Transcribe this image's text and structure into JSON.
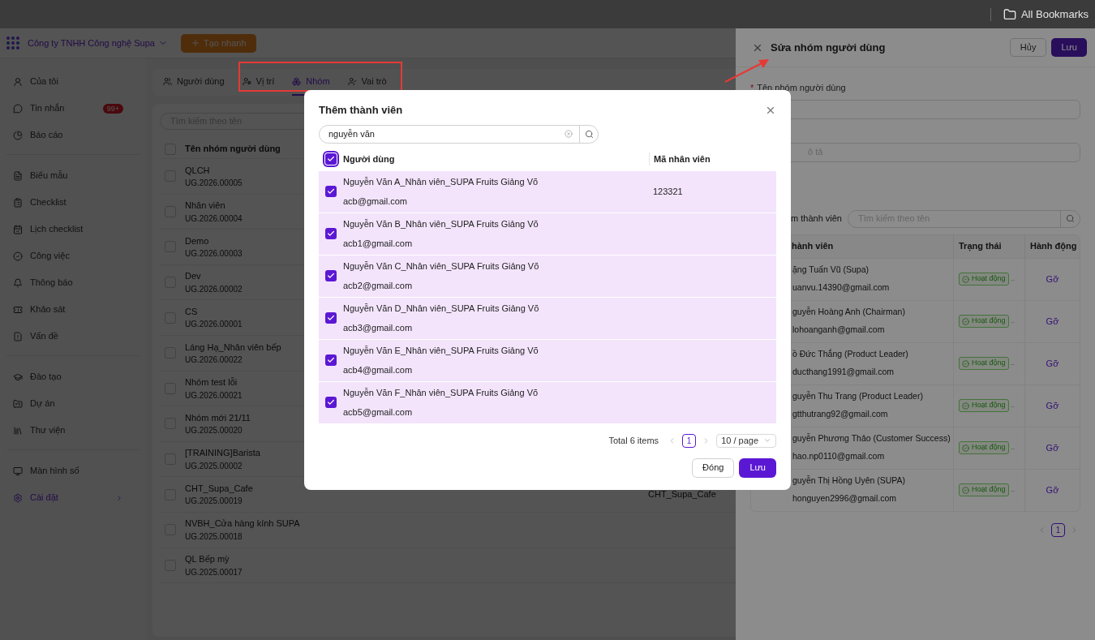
{
  "browser_bar": {
    "bookmarks": "All Bookmarks"
  },
  "header": {
    "company": "Công ty TNHH Công nghệ Supa",
    "quick_create": "Tạo nhanh"
  },
  "sidebar": {
    "sections": [
      {
        "items": [
          {
            "label": "Của tôi",
            "selected": false,
            "expandable": false
          },
          {
            "label": "Tin nhắn",
            "badge": "99+",
            "selected": false,
            "expandable": false
          },
          {
            "label": "Báo cáo",
            "selected": false,
            "expandable": false
          }
        ]
      },
      {
        "items": [
          {
            "label": "Biểu mẫu",
            "selected": false,
            "expandable": false
          },
          {
            "label": "Checklist",
            "selected": false,
            "expandable": false
          },
          {
            "label": "Lịch checklist",
            "selected": false,
            "expandable": false
          },
          {
            "label": "Công việc",
            "selected": false,
            "expandable": false
          },
          {
            "label": "Thông báo",
            "selected": false,
            "expandable": false
          },
          {
            "label": "Khảo sát",
            "selected": false,
            "expandable": false
          },
          {
            "label": "Vấn đề",
            "selected": false,
            "expandable": false
          }
        ]
      },
      {
        "items": [
          {
            "label": "Đào tạo",
            "selected": false,
            "expandable": false
          },
          {
            "label": "Dự án",
            "selected": false,
            "expandable": false
          },
          {
            "label": "Thư viện",
            "selected": false,
            "expandable": false
          }
        ]
      },
      {
        "items": [
          {
            "label": "Màn hình số",
            "selected": false,
            "expandable": false
          },
          {
            "label": "Cài đặt",
            "selected": true,
            "expandable": true
          }
        ]
      }
    ]
  },
  "tabs": [
    {
      "label": "Người dùng",
      "selected": false
    },
    {
      "label": "Vị trí",
      "selected": false
    },
    {
      "label": "Nhóm",
      "selected": true
    },
    {
      "label": "Vai trò",
      "selected": false
    }
  ],
  "group_list": {
    "search_placeholder": "Tìm kiếm theo tên",
    "select_all_checked": false,
    "column_header": "Tên nhóm người dùng",
    "rows": [
      {
        "name": "QLCH",
        "code": "UG.2026.00005",
        "checked": false
      },
      {
        "name": "Nhân viên",
        "code": "UG.2026.00004",
        "checked": false
      },
      {
        "name": "Demo",
        "code": "UG.2026.00003",
        "checked": false
      },
      {
        "name": "Dev",
        "code": "UG.2026.00002",
        "checked": false
      },
      {
        "name": "CS",
        "code": "UG.2026.00001",
        "checked": false
      },
      {
        "name": "Láng Hạ_Nhân viên bếp",
        "code": "UG.2026.00022",
        "checked": false
      },
      {
        "name": "Nhóm test lỗi",
        "code": "UG.2026.00021",
        "checked": false
      },
      {
        "name": "Nhóm mới 21/11",
        "code": "UG.2025.00020",
        "checked": false
      },
      {
        "name": "[TRAINING]Barista",
        "code": "UG.2025.00002",
        "checked": false
      },
      {
        "name": "CHT_Supa_Cafe",
        "code": "UG.2025.00019",
        "column_2": "CHT_Supa_Cafe",
        "checked": false
      },
      {
        "name": "NVBH_Cửa hàng kính SUPA",
        "code": "UG.2025.00018",
        "checked": false
      },
      {
        "name": "QL Bếp mỳ",
        "code": "UG.2025.00017",
        "checked": false
      }
    ]
  },
  "drawer": {
    "title": "Sửa nhóm người dùng",
    "cancel": "Hủy",
    "save": "Lưu",
    "name_required_mark": "*",
    "name_label": "Tên nhóm người dùng",
    "description_placeholder": "ô tả",
    "members_label": "m thành viên",
    "members_search_placeholder": "Tìm kiếm theo tên",
    "table": {
      "columns": [
        "hành viên",
        "Trạng thái",
        "Hành động"
      ],
      "rows": [
        {
          "name": "ặng Tuấn Vũ (Supa)",
          "email": "uanvu.14390@gmail.com",
          "status": "Hoạt động",
          "status_more": "..",
          "action": "Gỡ"
        },
        {
          "name": "guyễn Hoàng Anh (Chairman)",
          "email": "lohoanganh@gmail.com",
          "status": "Hoạt động",
          "status_more": "..",
          "action": "Gỡ"
        },
        {
          "name": "ồ Đức Thắng (Product Leader)",
          "email": "ducthang1991@gmail.com",
          "status": "Hoạt động",
          "status_more": "..",
          "action": "Gỡ"
        },
        {
          "name": "guyễn Thu Trang (Product Leader)",
          "email": "gtthutrang92@gmail.com",
          "status": "Hoạt động",
          "status_more": "..",
          "action": "Gỡ"
        },
        {
          "name": "guyễn Phương Thảo (Customer Success)",
          "email": "hao.np0110@gmail.com",
          "status": "Hoạt động",
          "status_more": "..",
          "action": "Gỡ"
        },
        {
          "name": "guyễn Thị Hồng Uyên (SUPA)",
          "email": "honguyen2996@gmail.com",
          "status": "Hoạt động",
          "status_more": "..",
          "action": "Gỡ"
        }
      ]
    },
    "page": "1"
  },
  "modal": {
    "title": "Thêm thành viên",
    "search_value": "nguyễn văn",
    "select_all_checked": true,
    "columns": [
      "Người dùng",
      "Mã nhân viên"
    ],
    "rows": [
      {
        "name": "Nguyễn Văn A_Nhân viên_SUPA Fruits Giảng Võ",
        "email": "acb@gmail.com",
        "employee_code": "123321",
        "checked": true
      },
      {
        "name": "Nguyễn Văn B_Nhân viên_SUPA Fruits Giảng Võ",
        "email": "acb1@gmail.com",
        "checked": true
      },
      {
        "name": "Nguyễn Văn C_Nhân viên_SUPA Fruits Giảng Võ",
        "email": "acb2@gmail.com",
        "checked": true
      },
      {
        "name": "Nguyễn Văn D_Nhân viên_SUPA Fruits Giảng Võ",
        "email": "acb3@gmail.com",
        "checked": true
      },
      {
        "name": "Nguyễn Văn E_Nhân viên_SUPA Fruits Giảng Võ",
        "email": "acb4@gmail.com",
        "checked": true
      },
      {
        "name": "Nguyễn Văn F_Nhân viên_SUPA Fruits Giảng Võ",
        "email": "acb5@gmail.com",
        "checked": true
      }
    ],
    "total": "Total 6 items",
    "page": "1",
    "page_size": "10 / page",
    "close": "Đóng",
    "save": "Lưu"
  }
}
